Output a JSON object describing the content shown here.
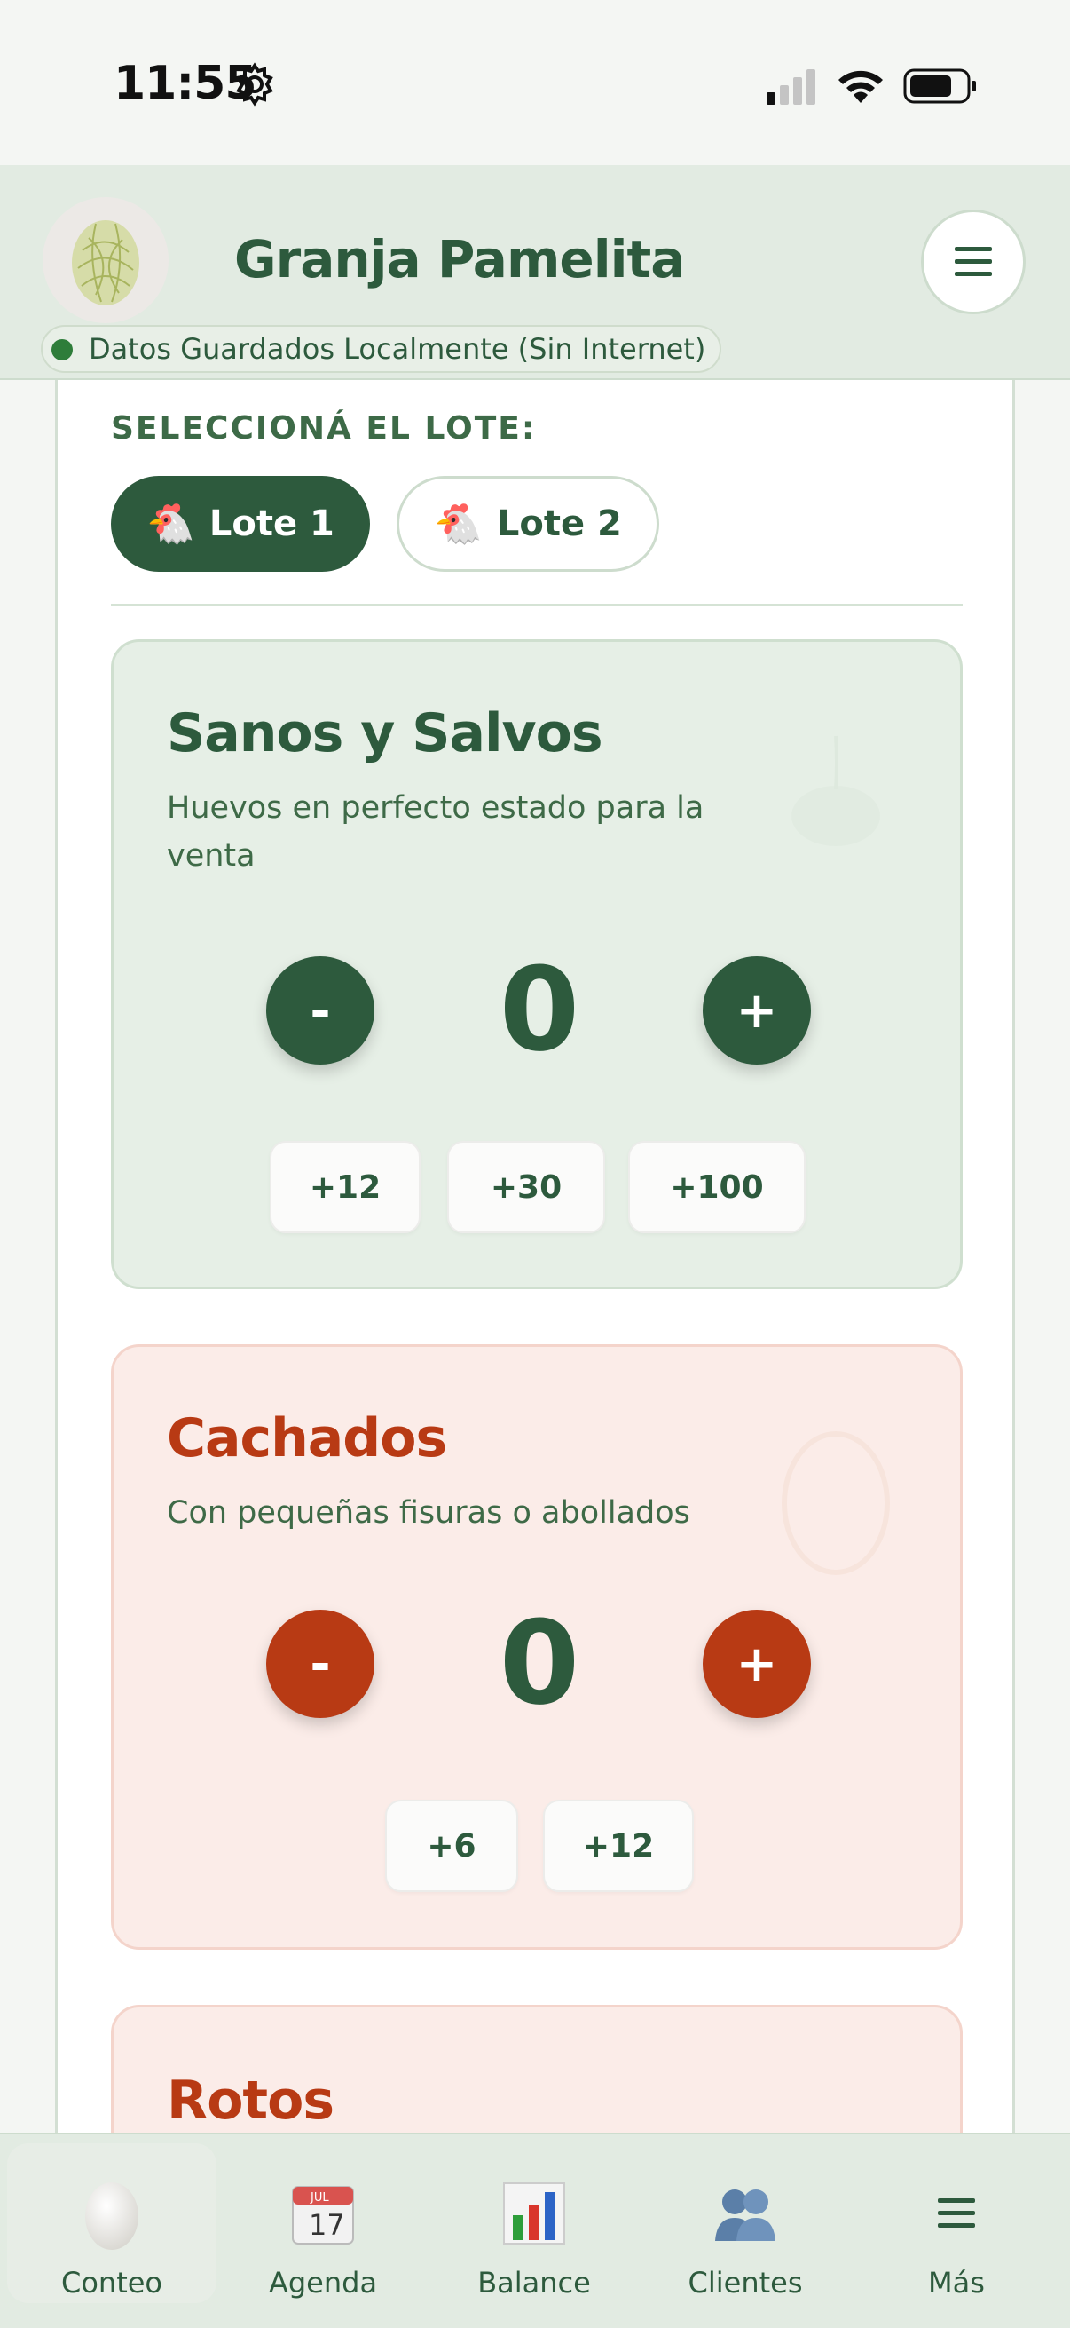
{
  "status_bar": {
    "time": "11:55"
  },
  "header": {
    "title": "Granja Pamelita",
    "offline_badge": "Datos Guardados Localmente (Sin Internet)",
    "status_color": "#2e7d3a"
  },
  "lote_selector": {
    "heading": "SELECCIONÁ EL LOTE:",
    "options": [
      {
        "label": "Lote 1",
        "selected": true
      },
      {
        "label": "Lote 2",
        "selected": false
      }
    ]
  },
  "categories": {
    "sanos": {
      "title": "Sanos y Salvos",
      "description": "Huevos en perfecto estado para la venta",
      "minus_label": "-",
      "plus_label": "+",
      "count": "0",
      "quick_adds": [
        "+12",
        "+30",
        "+100"
      ]
    },
    "cachados": {
      "title": "Cachados",
      "description": "Con pequeñas fisuras o abollados",
      "minus_label": "-",
      "plus_label": "+",
      "count": "0",
      "quick_adds": [
        "+6",
        "+12"
      ]
    },
    "rotos": {
      "title": "Rotos"
    }
  },
  "bottom_nav": {
    "items": [
      {
        "label": "Conteo",
        "icon": "egg-icon",
        "active": true
      },
      {
        "label": "Agenda",
        "icon": "calendar-icon",
        "calendar_month": "JUL",
        "calendar_day": "17"
      },
      {
        "label": "Balance",
        "icon": "bar-chart-icon"
      },
      {
        "label": "Clientes",
        "icon": "people-icon"
      },
      {
        "label": "Más",
        "icon": "hamburger-icon"
      }
    ]
  },
  "colors": {
    "primary_green": "#2d5a3d",
    "accent_red": "#b83a14",
    "header_bg": "#e2ebe2"
  }
}
